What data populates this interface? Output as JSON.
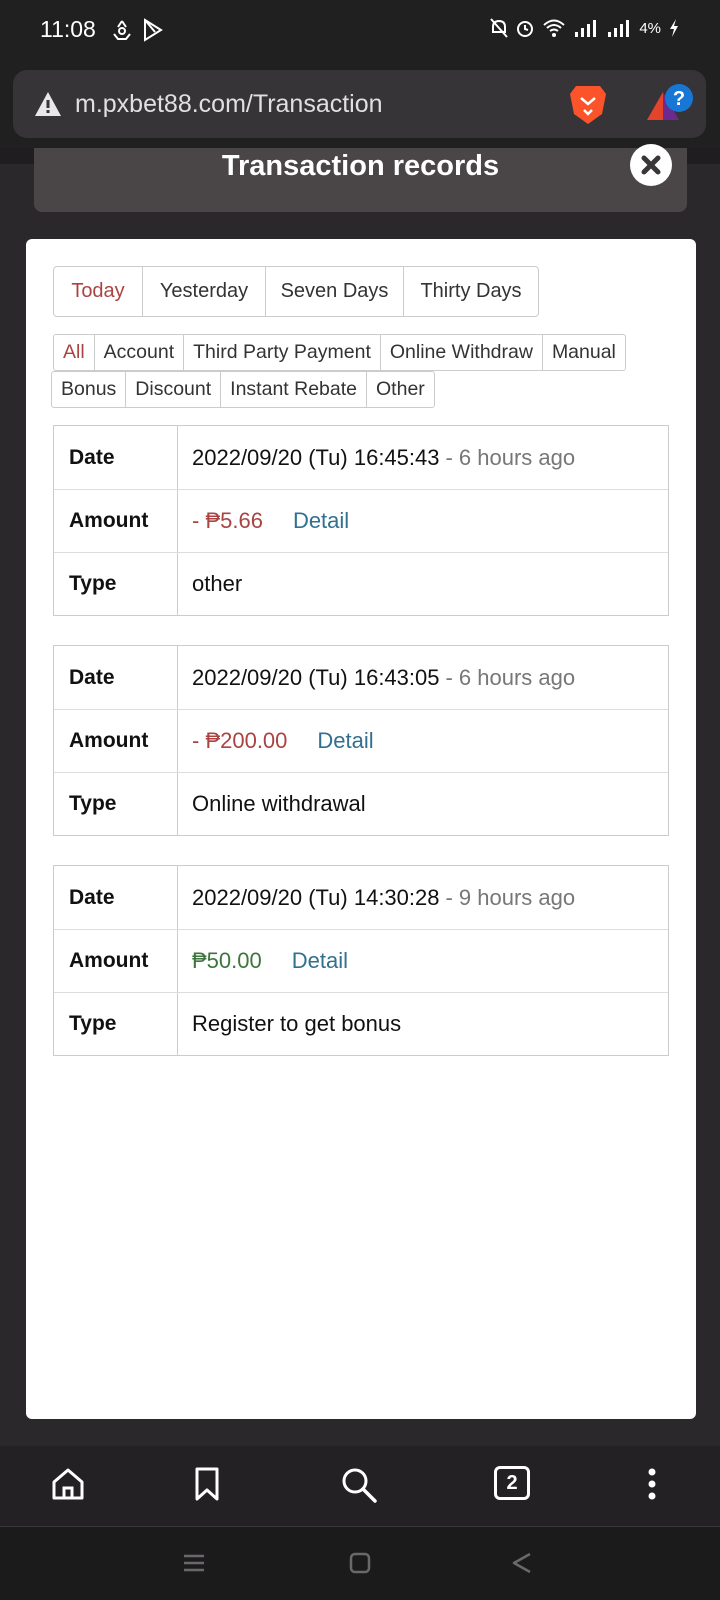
{
  "status": {
    "time": "11:08",
    "battery": "4%",
    "left_icons": [
      "recycle-icon",
      "play-store-icon"
    ],
    "right_icons": [
      "mute-icon",
      "alarm-icon",
      "wifi-icon",
      "signal-icon",
      "signal-icon",
      "charging-icon"
    ]
  },
  "browser": {
    "url": "m.pxbet88.com/Transaction",
    "tab_count": "2"
  },
  "modal": {
    "title": "Transaction records"
  },
  "day_tabs": [
    "Today",
    "Yesterday",
    "Seven Days",
    "Thirty Days"
  ],
  "type_tabs_row1": [
    "All",
    "Account",
    "Third Party Payment",
    "Online Withdraw",
    "Manual"
  ],
  "type_tabs_row2": [
    "Bonus",
    "Discount",
    "Instant Rebate",
    "Other"
  ],
  "labels": {
    "date": "Date",
    "amount": "Amount",
    "type": "Type",
    "detail": "Detail"
  },
  "records": [
    {
      "date": "2022/09/20 (Tu) 16:45:43",
      "ago": "- 6 hours ago",
      "amount": "- ₱5.66",
      "type": "other"
    },
    {
      "date": "2022/09/20 (Tu) 16:43:05",
      "ago": "- 6 hours ago",
      "amount": "- ₱200.00",
      "type": "Online withdrawal"
    },
    {
      "date": "2022/09/20 (Tu) 14:30:28",
      "ago": "- 9 hours ago",
      "amount": "₱50.00",
      "type": "Register to get bonus"
    }
  ],
  "colors": {
    "negative": "#a94442",
    "positive": "#3c763d",
    "link": "#31708f"
  }
}
